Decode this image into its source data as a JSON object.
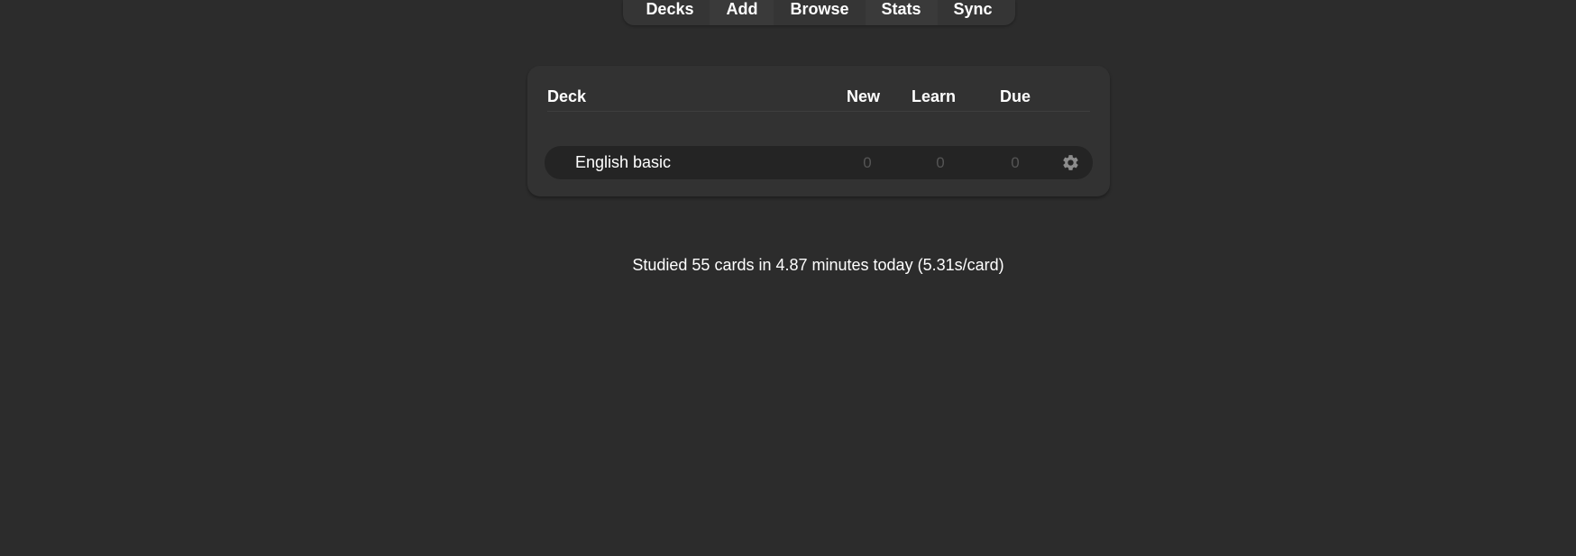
{
  "nav": {
    "decks": "Decks",
    "add": "Add",
    "browse": "Browse",
    "stats": "Stats",
    "sync": "Sync"
  },
  "table": {
    "headers": {
      "deck": "Deck",
      "new": "New",
      "learn": "Learn",
      "due": "Due"
    },
    "rows": [
      {
        "name": "English basic",
        "new": "0",
        "learn": "0",
        "due": "0",
        "options_icon": "gear-icon"
      }
    ]
  },
  "studied_text": "Studied 55 cards in 4.87 minutes today (5.31s/card)",
  "colors": {
    "background": "#2c2c2c",
    "card": "#323232",
    "row": "#242424",
    "text": "#ffffff",
    "zero_count": "#555555"
  }
}
